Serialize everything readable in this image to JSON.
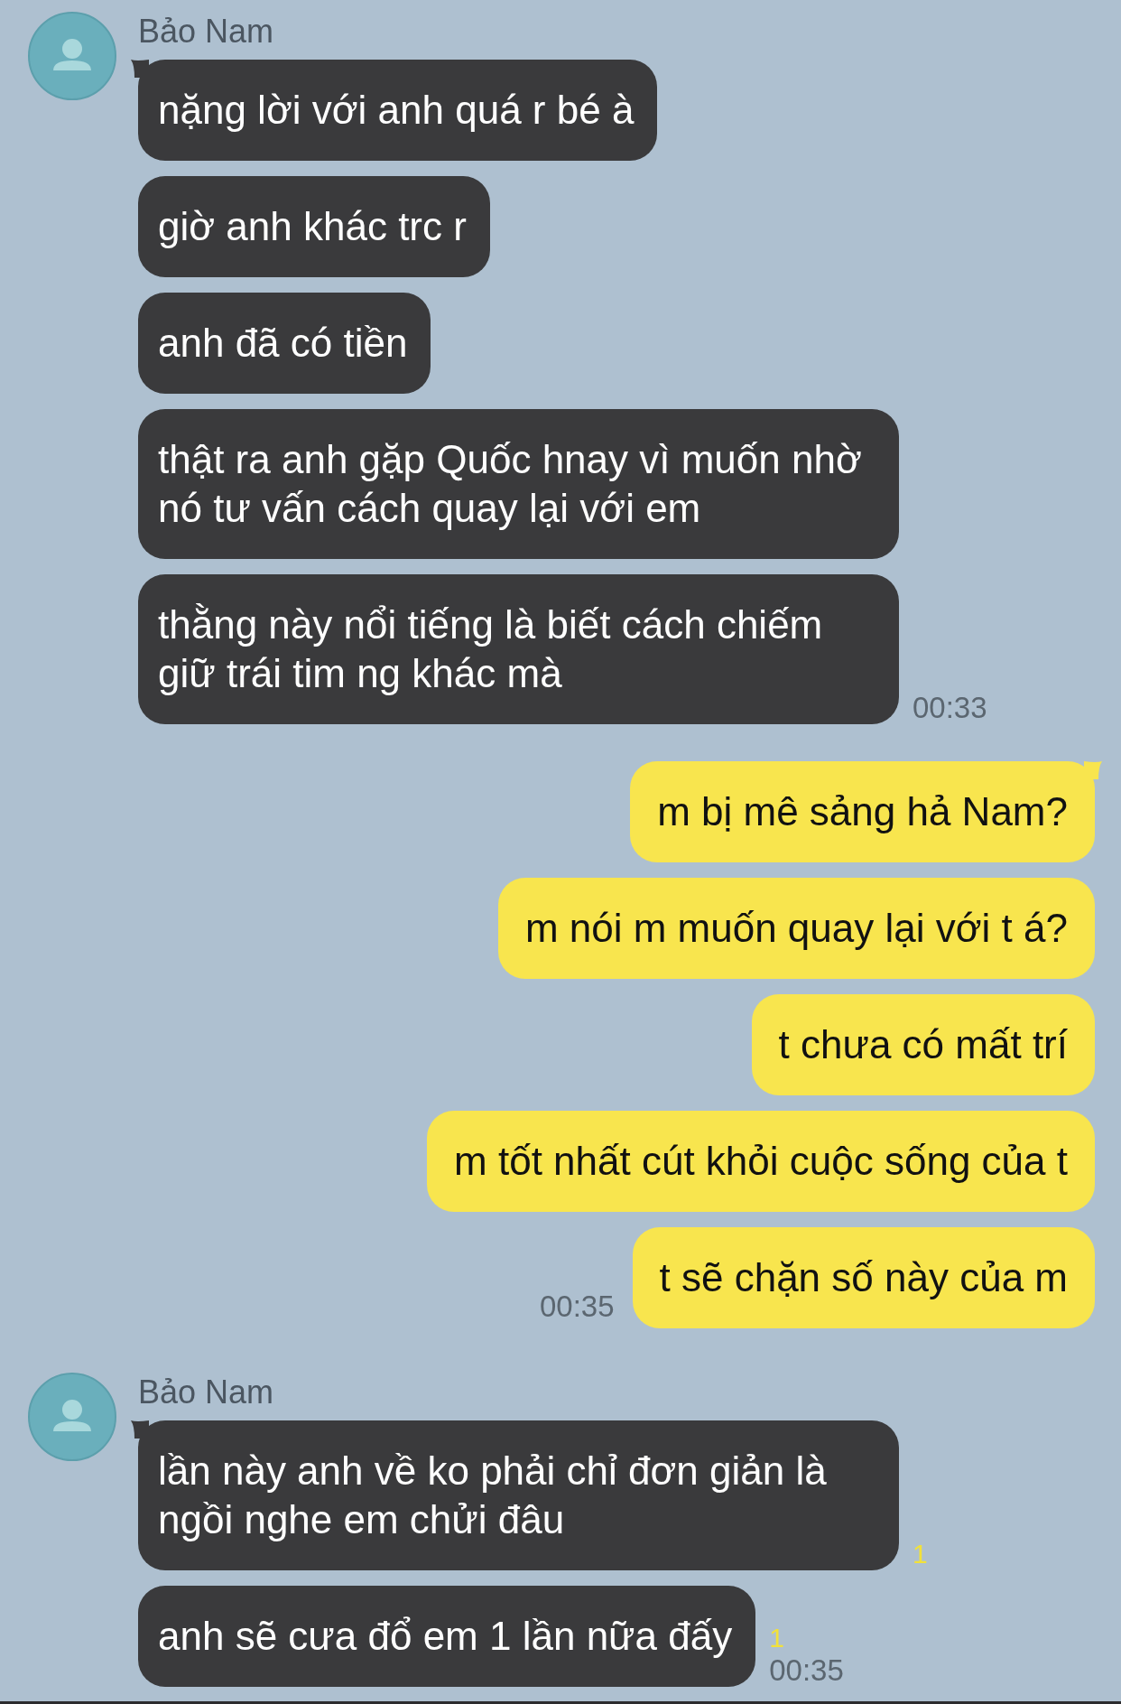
{
  "groups": [
    {
      "kind": "incoming",
      "sender": "Bảo Nam",
      "time": "00:33",
      "messages": [
        {
          "text": "nặng lời với anh quá r bé à"
        },
        {
          "text": "giờ anh khác trc r"
        },
        {
          "text": "anh đã có tiền"
        },
        {
          "text": "thật ra anh gặp Quốc hnay vì muốn nhờ nó tư vấn cách quay lại với em"
        },
        {
          "text": "thằng này nổi tiếng là biết cách chiếm giữ trái tim ng khác mà"
        }
      ]
    },
    {
      "kind": "outgoing",
      "time": "00:35",
      "messages": [
        {
          "text": "m bị mê sảng hả Nam?"
        },
        {
          "text": "m nói m muốn quay lại với t á?"
        },
        {
          "text": "t chưa có mất trí"
        },
        {
          "text": "m tốt nhất cút khỏi cuộc sống của t"
        },
        {
          "text": "t sẽ chặn số này của m"
        }
      ]
    },
    {
      "kind": "incoming",
      "sender": "Bảo Nam",
      "time": "00:35",
      "messages": [
        {
          "text": "lần này anh về ko phải chỉ đơn giản là ngồi nghe em chửi đâu",
          "unread": "1"
        },
        {
          "text": "anh sẽ cưa đổ em 1 lần nữa đấy",
          "unread": "1"
        }
      ]
    }
  ]
}
